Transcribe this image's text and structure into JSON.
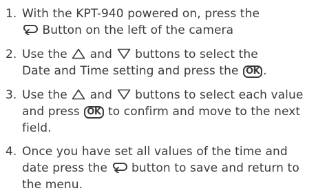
{
  "steps": [
    {
      "number": "1.",
      "line1": "With the KPT-940 powered on, press the",
      "line2_text": " Button on the left of the camera",
      "line2_icon": "return-icon"
    },
    {
      "number": "2.",
      "pre": "Use the ",
      "icon_up": "up-triangle-icon",
      "mid": " and ",
      "icon_down": "down-triangle-icon",
      "post1": " buttons to select the",
      "line2_pre": "Date and Time setting and press the ",
      "ok_label": "OK",
      "line2_post": "."
    },
    {
      "number": "3.",
      "pre": "Use the ",
      "icon_up": "up-triangle-icon",
      "mid": " and ",
      "icon_down": "down-triangle-icon",
      "post1": " buttons to select each value",
      "line2_pre": "and press ",
      "ok_label": "OK",
      "line2_post": " to confirm and move to the next",
      "line3": "field."
    },
    {
      "number": "4.",
      "line1": "Once you have set all values of the time and",
      "line2_pre": "date press the ",
      "line2_icon": "return-icon",
      "line2_post": " button to save and return to",
      "line3": "the menu."
    }
  ],
  "colors": {
    "text": "#3b3b3b",
    "background": "#ffffff"
  }
}
